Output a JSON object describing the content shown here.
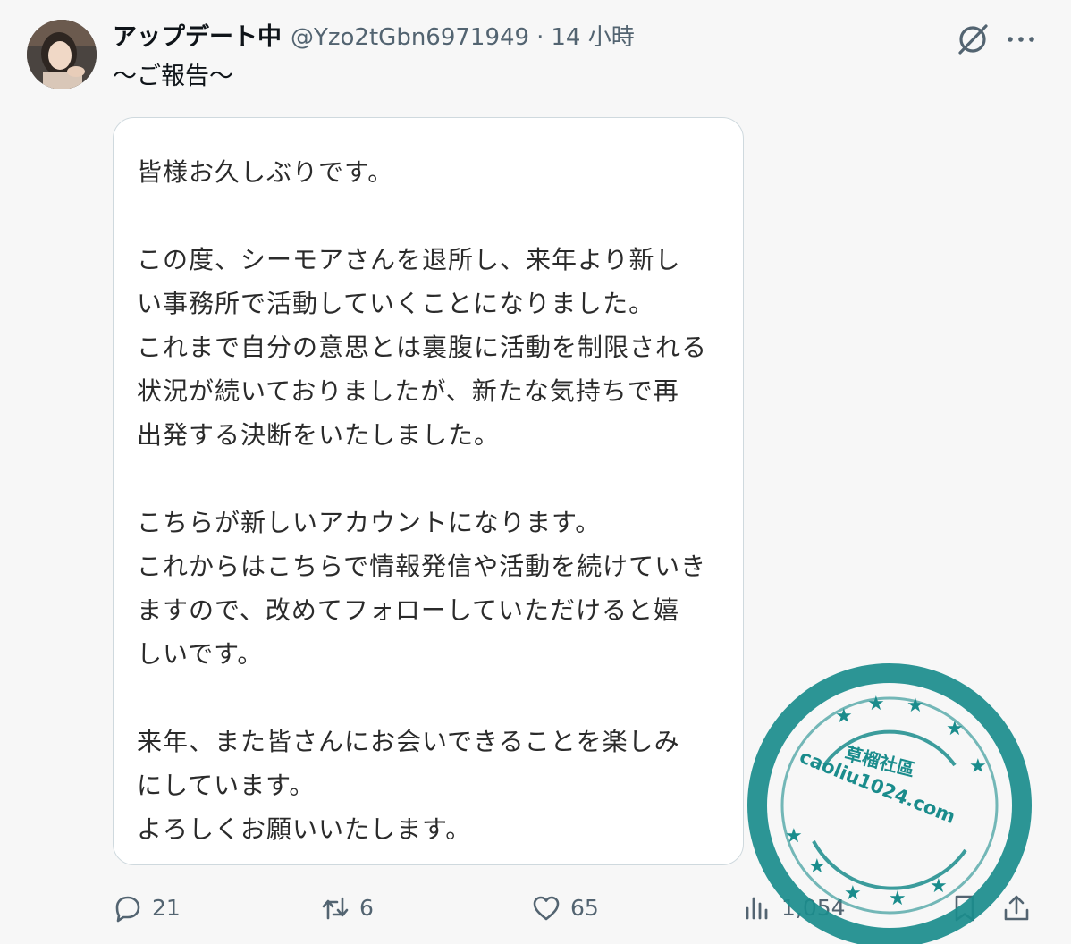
{
  "author": {
    "display_name": "アップデート中",
    "handle": "@Yzo2tGbn6971949",
    "separator": "·",
    "timestamp": "14 小時"
  },
  "post": {
    "caption": "～ご報告～"
  },
  "media": {
    "paragraphs": [
      "皆様お久しぶりです。",
      "この度、シーモアさんを退所し、来年より新し\nい事務所で活動していくことになりました。\nこれまで自分の意思とは裏腹に活動を制限される\n状況が続いておりましたが、新たな気持ちで再\n出発する決断をいたしました。",
      "こちらが新しいアカウントになります。\nこれからはこちらで情報発信や活動を続けていき\nますので、改めてフォローしていただけると嬉\nしいです。",
      "来年、また皆さんにお会いできることを楽しみ\nにしています。\nよろしくお願いいたします。"
    ]
  },
  "actions": {
    "reply_count": "21",
    "retweet_count": "6",
    "like_count": "65",
    "views_count": "1,054"
  },
  "icons": {
    "grok": "grok-icon",
    "more": "more-icon",
    "reply": "reply-icon",
    "retweet": "retweet-icon",
    "like": "heart-icon",
    "views": "analytics-icon",
    "bookmark": "bookmark-icon",
    "share": "share-icon"
  },
  "watermark": {
    "line1": "草榴社區",
    "line2": "caoliu1024.com"
  },
  "colors": {
    "text_primary": "#0f1419",
    "text_secondary": "#536471",
    "card_border": "#cfd9de",
    "stamp_teal": "#1a8c8c"
  }
}
